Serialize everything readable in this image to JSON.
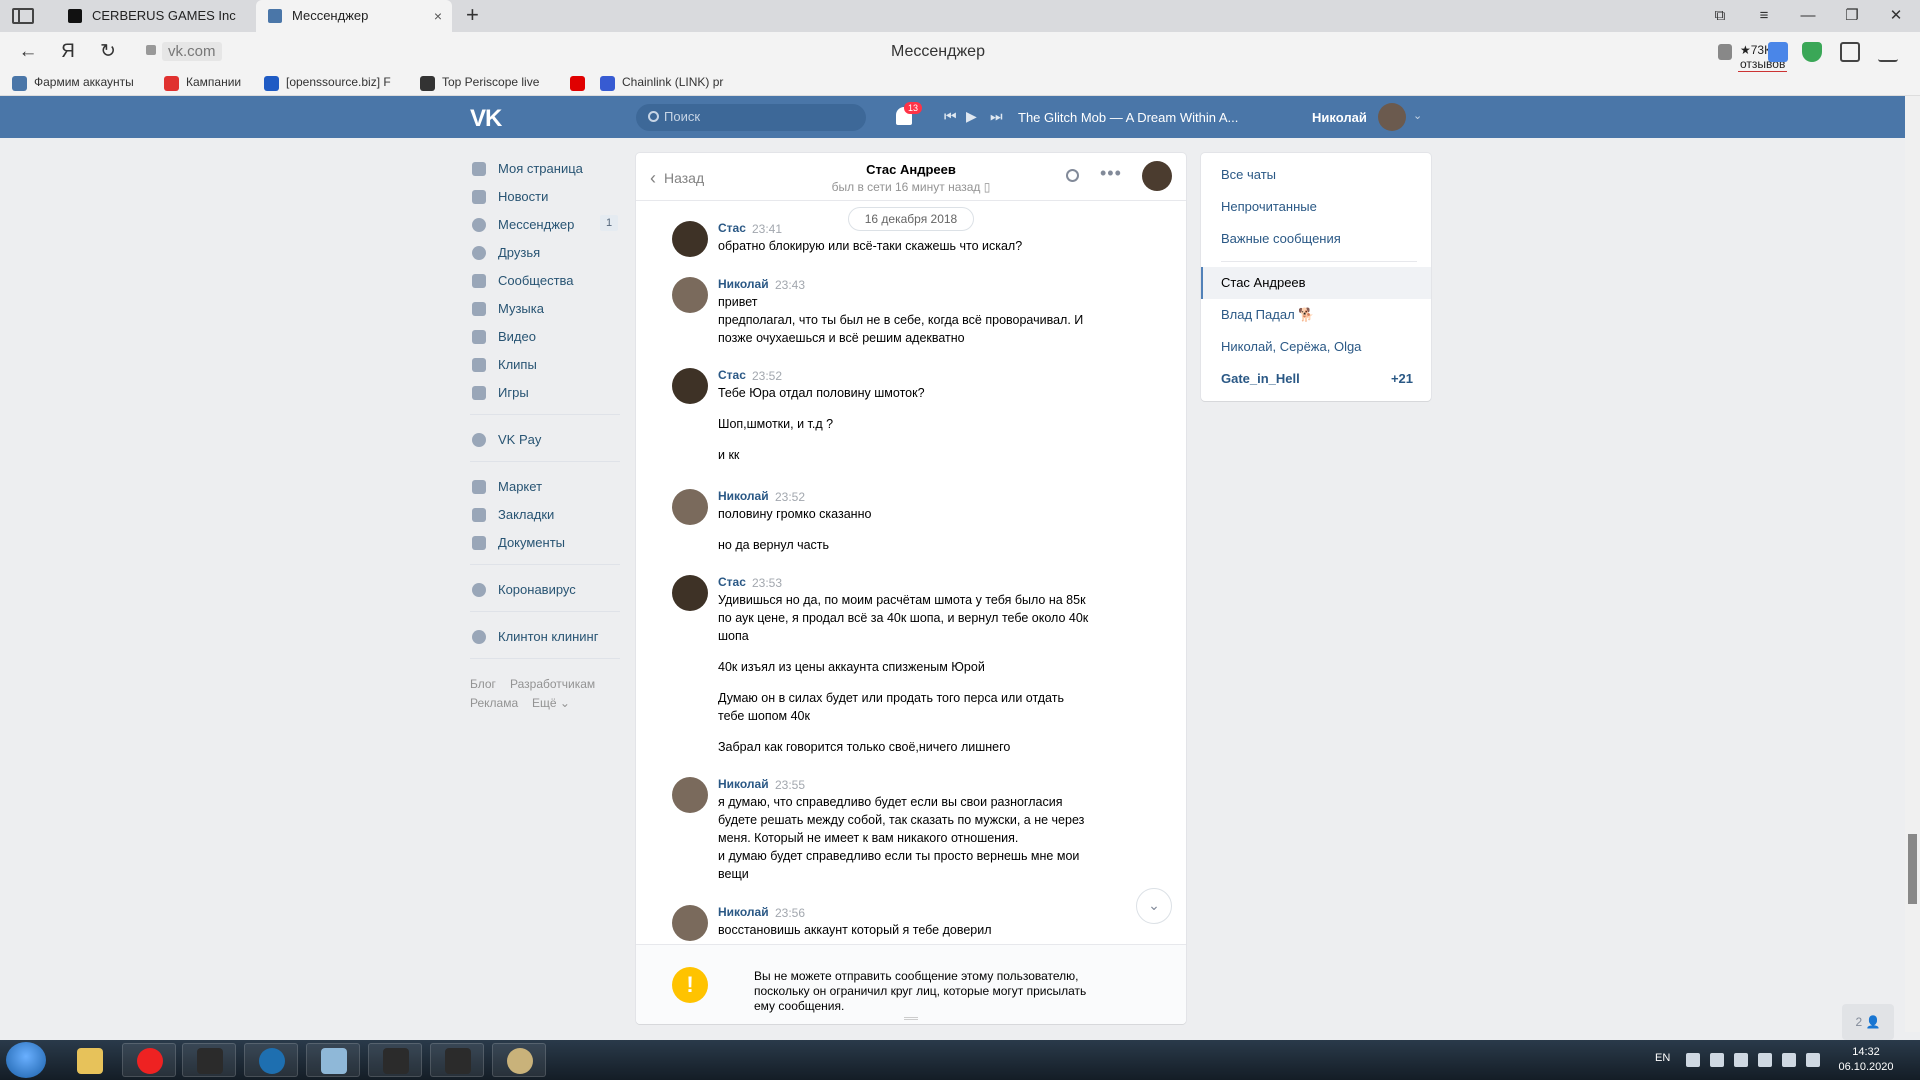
{
  "browser": {
    "tabs": [
      {
        "title": "CERBERUS GAMES Inc"
      },
      {
        "title": "Мессенджер",
        "close": "×"
      }
    ],
    "new_tab": "+",
    "url": "vk.com",
    "page_title": "Мессенджер",
    "reviews": "★73К отзывов",
    "bookmarks": [
      {
        "label": "Фармим аккаунты",
        "color": "#4a76a8"
      },
      {
        "label": "Кампании",
        "color": "#e0312f"
      },
      {
        "label": "[openssource.biz] F",
        "color": "#1f5bc4"
      },
      {
        "label": "Top Periscope live",
        "color": "#333333"
      },
      {
        "label": "",
        "color": "#e00000"
      },
      {
        "label": "Chainlink (LINK) pr",
        "color": "#375bd2"
      }
    ]
  },
  "vk_header": {
    "logo": "VK",
    "search_placeholder": "Поиск",
    "notifications_count": "13",
    "track": "The Glitch Mob — A Dream Within A...",
    "user_name": "Николай"
  },
  "left_menu": {
    "items": [
      {
        "label": "Моя страница",
        "icon": "home-icon"
      },
      {
        "label": "Новости",
        "icon": "news-icon"
      },
      {
        "label": "Мессенджер",
        "icon": "messenger-icon",
        "badge": "1"
      },
      {
        "label": "Друзья",
        "icon": "friends-icon"
      },
      {
        "label": "Сообщества",
        "icon": "communities-icon"
      },
      {
        "label": "Музыка",
        "icon": "music-icon"
      },
      {
        "label": "Видео",
        "icon": "video-icon"
      },
      {
        "label": "Клипы",
        "icon": "clips-icon"
      },
      {
        "label": "Игры",
        "icon": "games-icon"
      },
      {
        "label": "VK Pay",
        "icon": "vkpay-icon"
      },
      {
        "label": "Маркет",
        "icon": "market-icon"
      },
      {
        "label": "Закладки",
        "icon": "bookmarks-icon"
      },
      {
        "label": "Документы",
        "icon": "documents-icon"
      },
      {
        "label": "Коронавирус",
        "icon": "coronavirus-icon"
      },
      {
        "label": "Клинтон клининг",
        "icon": "group-icon"
      }
    ],
    "footer": [
      "Блог",
      "Разработчикам",
      "Реклама",
      "Ещё ⌄"
    ]
  },
  "chat": {
    "back_label": "Назад",
    "peer_name": "Стас Андреев",
    "peer_status": "был в сети 16 минут назад ▯",
    "date": "16 декабря 2018",
    "messages": [
      {
        "author": "Стас",
        "time": "23:41",
        "lines": [
          "обратно блокирую или всё-таки скажешь что искал?"
        ]
      },
      {
        "author": "Николай",
        "time": "23:43",
        "lines": [
          "привет",
          "предполагал, что ты был не в себе, когда всё проворачивал. И",
          "позже очухаешься и всё решим адекватно"
        ]
      },
      {
        "author": "Стас",
        "time": "23:52",
        "lines": [
          "Тебе Юра отдал половину шмоток?",
          "Шоп,шмотки, и т.д ?",
          "и кк"
        ]
      },
      {
        "author": "Николай",
        "time": "23:52",
        "lines": [
          "половину громко сказанно",
          "но да вернул часть"
        ]
      },
      {
        "author": "Стас",
        "time": "23:53",
        "lines": [
          "Удивишься но да, по моим расчётам шмота у тебя было на 85к",
          "по аук цене, я продал всё за 40к шопа, и вернул тебе около 40к",
          "шопа",
          "40к изъял из цены аккаунта спизженым Юрой",
          "Думаю он в силах будет или продать того перса или отдать",
          "тебе шопом 40к",
          "Забрал как говорится только своё,ничего лишнего"
        ]
      },
      {
        "author": "Николай",
        "time": "23:55",
        "lines": [
          "я думаю, что справедливо будет если вы свои разногласия",
          "будете решать между собой, так сказать по мужски, а не через",
          "меня. Который не имеет к вам никакого отношения.",
          "и думаю будет справедливо если ты просто вернешь мне мои",
          "вещи"
        ]
      },
      {
        "author": "Николай",
        "time": "23:56",
        "lines": [
          "восстановишь аккаунт который я тебе доверил"
        ]
      }
    ],
    "warning_lines": [
      "Вы не можете отправить сообщение этому пользователю,",
      "поскольку он ограничил круг лиц, которые могут присылать",
      "ему сообщения."
    ],
    "warning_icon": "!"
  },
  "right_panel": {
    "filters": [
      "Все чаты",
      "Непрочитанные",
      "Важные сообщения"
    ],
    "chats": [
      {
        "label": "Стас Андреев",
        "selected": true
      },
      {
        "label": "Влад Падал 🐕"
      },
      {
        "label": "Николай, Серёжа, Olga"
      },
      {
        "label": "Gate_in_Hell",
        "count": "+21"
      }
    ]
  },
  "friends_button": "2 👤",
  "taskbar": {
    "lang": "EN",
    "time": "14:32",
    "date": "06.10.2020"
  }
}
